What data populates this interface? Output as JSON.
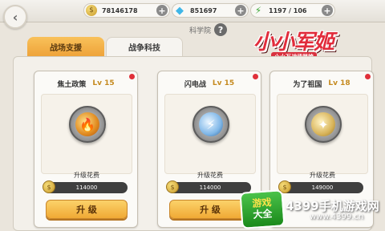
{
  "topbar": {
    "gold": "78146178",
    "diamonds": "851697",
    "energy": "1197 / 106"
  },
  "icons": {
    "back": "back-arrow-icon",
    "gold": "gold-coin-icon",
    "diamond": "diamond-icon",
    "energy": "energy-lightning-icon",
    "add": "plus-icon",
    "help": "question-icon"
  },
  "tabs": [
    {
      "label": "战场支援",
      "active": true
    },
    {
      "label": "战争科技",
      "active": false
    }
  ],
  "subtitle": "科学院",
  "logo": {
    "title": "小小军姬",
    "subtitle": "小小万战武器娘"
  },
  "cost_label": "升级花费",
  "upgrade_label": "升 级",
  "cards": [
    {
      "name": "焦土政策",
      "level": "Lv 15",
      "cost": "114000",
      "emblem": "scorched-earth-icon"
    },
    {
      "name": "闪电战",
      "level": "Lv 15",
      "cost": "114000",
      "emblem": "blitzkrieg-icon"
    },
    {
      "name": "为了祖国",
      "level": "Lv 18",
      "cost": "149000",
      "emblem": "for-motherland-icon"
    }
  ],
  "watermark": {
    "badge_top": "游戏",
    "badge_bottom": "大全",
    "site": "4399手机游戏网",
    "url": "www.4399.cn"
  },
  "colors": {
    "accent": "#f0a935",
    "notify": "#e0303a",
    "logo_red": "#e12c3b"
  }
}
